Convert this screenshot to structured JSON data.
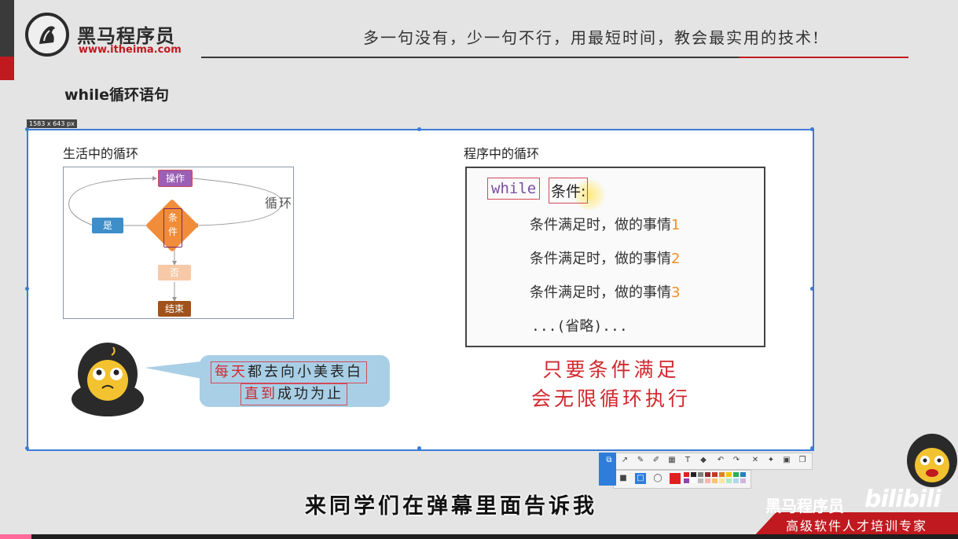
{
  "header": {
    "brand_name": "黑马程序员",
    "brand_url": "www.itheima.com",
    "slogan": "多一句没有，少一句不行，用最短时间，教会最实用的技术!"
  },
  "page_title": "while循环语句",
  "selection": {
    "size_label": "1583 x 643  px"
  },
  "left_panel": {
    "heading": "生活中的循环",
    "flow": {
      "op": "操作",
      "cond": "条件",
      "yes": "是",
      "no": "否",
      "end": "结束",
      "loop_label": "循环"
    },
    "bubble": {
      "line1": [
        "每天",
        "都去向小美表白"
      ],
      "line2": [
        "直到",
        "成功为止"
      ]
    }
  },
  "right_panel": {
    "heading": "程序中的循环",
    "keyword": "while",
    "condition": "条件",
    "colon": ":",
    "lines": [
      {
        "text": "条件满足时，做的事情",
        "num": "1"
      },
      {
        "text": "条件满足时，做的事情",
        "num": "2"
      },
      {
        "text": "条件满足时，做的事情",
        "num": "3"
      }
    ],
    "ellipsis": "...(省略)...",
    "note_line1": "只要条件满足",
    "note_line2": "会无限循环执行"
  },
  "toolbar": {
    "colors": [
      "#e02020",
      "#222222",
      "#7f7f7f",
      "#8b2c2c",
      "#c0392b",
      "#e67e22",
      "#f1c40f",
      "#27ae60",
      "#2980b9",
      "#8e44ad",
      "#ffffff",
      "#bdbdbd",
      "#f5b7b1",
      "#f8c471",
      "#f9e79f",
      "#abebc6",
      "#aed6f1",
      "#d2b4de"
    ]
  },
  "subtitle": "来同学们在弹幕里面告诉我",
  "branding": {
    "name": "黑马程序员",
    "bili": "bilibili",
    "sub": "高级软件人才培训专家"
  }
}
